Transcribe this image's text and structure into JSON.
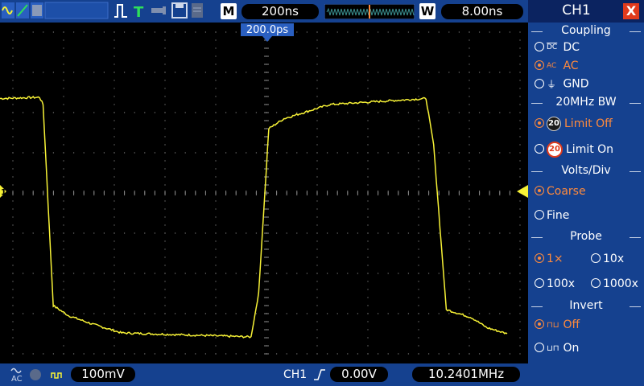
{
  "top": {
    "mode_label": "M",
    "timebase": "200ns",
    "window_label": "W",
    "window_timebase": "8.00ns",
    "trigger_position": "200.0ps",
    "trigger_letter": "T"
  },
  "bottom": {
    "volts_per_div": "100mV",
    "channel_label": "CH1",
    "trigger_level": "0.00V",
    "frequency": "10.2401MHz"
  },
  "side": {
    "title": "CH1",
    "close": "X",
    "coupling_header": "Coupling",
    "coupling_options": [
      {
        "label": "DC",
        "icon": "dc-coupling-icon",
        "selected": false
      },
      {
        "label": "AC",
        "icon": "ac-coupling-icon",
        "selected": true
      },
      {
        "label": "GND",
        "icon": "ground-icon",
        "selected": false
      }
    ],
    "bw_header": "20MHz BW",
    "bw_options": [
      {
        "label": "Limit Off",
        "badge": "20",
        "selected": true
      },
      {
        "label": "Limit On",
        "badge": "20",
        "selected": false
      }
    ],
    "vdiv_header": "Volts/Div",
    "vdiv_options": [
      {
        "label": "Coarse",
        "selected": true
      },
      {
        "label": "Fine",
        "selected": false
      }
    ],
    "probe_header": "Probe",
    "probe_options": [
      {
        "label": "1×",
        "selected": true
      },
      {
        "label": "10x",
        "selected": false
      },
      {
        "label": "100x",
        "selected": false
      },
      {
        "label": "1000x",
        "selected": false
      }
    ],
    "invert_header": "Invert",
    "invert_options": [
      {
        "label": "Off",
        "selected": true
      },
      {
        "label": "On",
        "selected": false
      }
    ]
  },
  "markers": {
    "channel_marker": "1"
  },
  "colors": {
    "trace": "#f7f236",
    "panel": "#15418f",
    "selected": "#ff8a3c",
    "close": "#e03a1c"
  },
  "waveform": {
    "type": "square",
    "frequency": "10.2401MHz",
    "segments": [
      {
        "t_div": 0.0,
        "v_div": 2.35
      },
      {
        "t_div": 0.78,
        "v_div": 2.38
      },
      {
        "t_div": 0.85,
        "v_div": 2.2
      },
      {
        "t_div": 1.05,
        "v_div": -2.8
      },
      {
        "t_div": 1.35,
        "v_div": -3.05
      },
      {
        "t_div": 1.8,
        "v_div": -3.25
      },
      {
        "t_div": 2.4,
        "v_div": -3.48
      },
      {
        "t_div": 4.95,
        "v_div": -3.58
      },
      {
        "t_div": 5.1,
        "v_div": -2.5
      },
      {
        "t_div": 5.3,
        "v_div": 1.6
      },
      {
        "t_div": 5.6,
        "v_div": 1.85
      },
      {
        "t_div": 6.5,
        "v_div": 2.2
      },
      {
        "t_div": 8.4,
        "v_div": 2.35
      },
      {
        "t_div": 8.55,
        "v_div": 1.2
      },
      {
        "t_div": 8.8,
        "v_div": -2.9
      },
      {
        "t_div": 9.3,
        "v_div": -3.1
      },
      {
        "t_div": 9.6,
        "v_div": -3.35
      },
      {
        "t_div": 10.0,
        "v_div": -3.5
      }
    ]
  }
}
